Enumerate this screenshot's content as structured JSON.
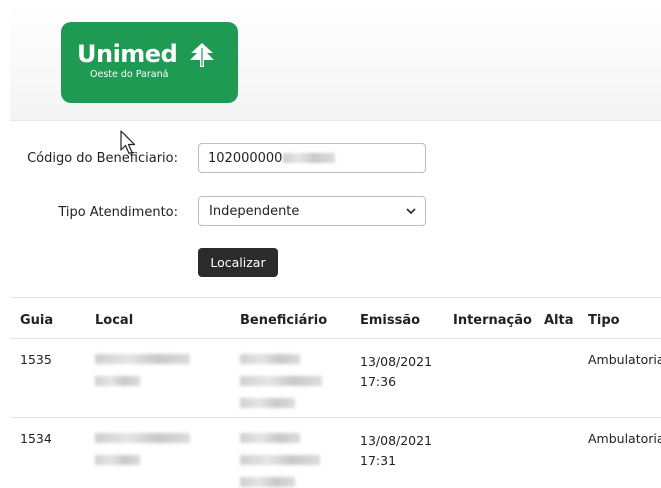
{
  "colors": {
    "brand_green": "#1e9a52",
    "button_bg": "#2b2b2b",
    "border": "#bdbdbd"
  },
  "logo": {
    "name": "Unimed",
    "subtitle": "Oeste do Paraná",
    "icon": "unimed-tree-icon"
  },
  "form": {
    "codigo_label": "Código do Beneficiario:",
    "codigo_value_visible": "102000000",
    "tipo_label": "Tipo Atendimento:",
    "tipo_selected": "Independente",
    "search_button": "Localizar"
  },
  "table": {
    "columns": [
      "Guia",
      "Local",
      "Beneficiário",
      "Emissão",
      "Internação",
      "Alta",
      "Tipo"
    ],
    "rows": [
      {
        "guia": "1535",
        "emissao_date": "13/08/2021",
        "emissao_time": "17:36",
        "internacao": "",
        "alta": "",
        "tipo": "Ambulatorial"
      },
      {
        "guia": "1534",
        "emissao_date": "13/08/2021",
        "emissao_time": "17:31",
        "internacao": "",
        "alta": "",
        "tipo": "Ambulatorial"
      }
    ]
  }
}
